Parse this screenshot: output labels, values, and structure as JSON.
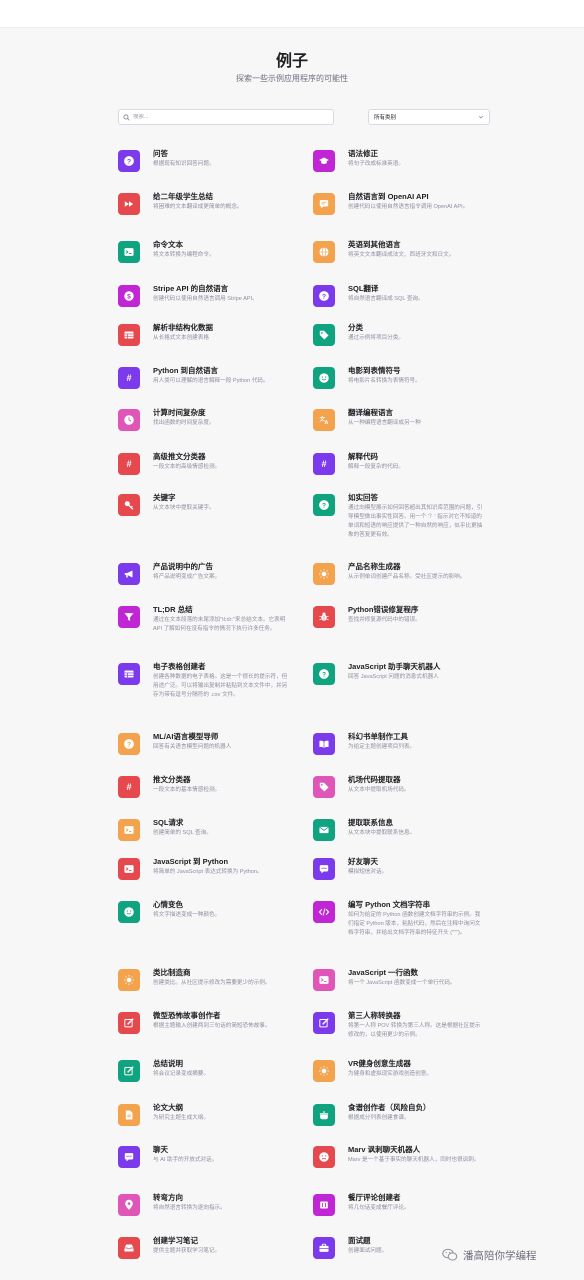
{
  "header": {
    "title": "例子",
    "subtitle": "探索一些示例应用程序的可能性"
  },
  "search": {
    "placeholder": "搜索..."
  },
  "category_select": {
    "value": "所有类别"
  },
  "colors": {
    "purple": "#7c3aed",
    "red": "#e5484d",
    "orange": "#f3a24d",
    "green": "#10a37f",
    "pink": "#e056b8",
    "magenta": "#c026d3"
  },
  "examples": [
    {
      "title": "问答",
      "desc": "根据现有知识回答问题。",
      "color": "#7c3aed",
      "icon": "question-icon"
    },
    {
      "title": "语法修正",
      "desc": "将句子改成标准英语。",
      "color": "#c026d3",
      "icon": "graduation-cap-icon"
    },
    {
      "title": "给二年级学生总结",
      "desc": "将困难的文本翻译成更简单的概念。",
      "color": "#e5484d",
      "icon": "fast-forward-icon"
    },
    {
      "title": "自然语言到 OpenAI API",
      "desc": "创建代码以使用自然语言指令调用 OpenAI API。",
      "color": "#f3a24d",
      "icon": "message-code-icon"
    },
    {
      "title": "命令文本",
      "desc": "将文本转换为编程命令。",
      "color": "#10a37f",
      "icon": "terminal-icon"
    },
    {
      "title": "英语到其他语言",
      "desc": "将英文文本翻译成法文、西班牙文和日文。",
      "color": "#f3a24d",
      "icon": "globe-icon"
    },
    {
      "title": "Stripe API 的自然语言",
      "desc": "创建代码以使用自然语言调用 Stripe API。",
      "color": "#c026d3",
      "icon": "dollar-icon"
    },
    {
      "title": "SQL翻译",
      "desc": "将自然语言翻译成 SQL 查询。",
      "color": "#7c3aed",
      "icon": "question-icon"
    },
    {
      "title": "解析非结构化数据",
      "desc": "从长格式文本创建表格",
      "color": "#e5484d",
      "icon": "table-icon"
    },
    {
      "title": "分类",
      "desc": "通过示例将项目分类。",
      "color": "#10a37f",
      "icon": "tag-icon"
    },
    {
      "title": "Python 到自然语言",
      "desc": "用人类可以理解的语言解释一段 Python 代码。",
      "color": "#7c3aed",
      "icon": "hashtag-icon"
    },
    {
      "title": "电影到表情符号",
      "desc": "将电影片名转换为表情符号。",
      "color": "#10a37f",
      "icon": "smile-icon"
    },
    {
      "title": "计算时间复杂度",
      "desc": "找出函数的时间复杂度。",
      "color": "#e056b8",
      "icon": "clock-icon"
    },
    {
      "title": "翻译编程语言",
      "desc": "从一种编程语言翻译成另一种",
      "color": "#f3a24d",
      "icon": "translate-icon"
    },
    {
      "title": "高级推文分类器",
      "desc": "一段文本的高级情感检测。",
      "color": "#e5484d",
      "icon": "hashtag-icon"
    },
    {
      "title": "解释代码",
      "desc": "解释一段复杂的代码。",
      "color": "#7c3aed",
      "icon": "hashtag-icon"
    },
    {
      "title": "关键字",
      "desc": "从文本块中提取关键字。",
      "color": "#e5484d",
      "icon": "key-icon"
    },
    {
      "title": "如实回答",
      "desc": "通过向模型展示如何回答超出其知识库范围的问题，引导模型做出事实性回答。用一个 '？' 指示对它不知道的单词和短语的响应提供了一种自然的响应，似乎比更抽象的答复更有效。",
      "color": "#10a37f",
      "icon": "question-icon"
    },
    {
      "title": "产品说明中的广告",
      "desc": "将产品说明变成广告文案。",
      "color": "#7c3aed",
      "icon": "megaphone-icon"
    },
    {
      "title": "产品名称生成器",
      "desc": "从示例单词创建产品名称。受社区提示的影响。",
      "color": "#f3a24d",
      "icon": "lightbulb-icon"
    },
    {
      "title": "TL;DR 总结",
      "desc": "通过在文本段落的末尾添加\"tl;dr:\"来总结文本。它表明 API 了解如何在没有指令的情况下执行许多任务。",
      "color": "#c026d3",
      "icon": "filter-icon"
    },
    {
      "title": "Python错误修复程序",
      "desc": "查找并修复源代码中的错误。",
      "color": "#e5484d",
      "icon": "bug-icon"
    },
    {
      "title": "电子表格创建者",
      "desc": "创建各种数据的电子表格。这是一个很长的提示符，但用途广泛。可以将输出复制并粘贴到文本文件中，并另存为带有逗号分隔符的 .csv 文件。",
      "color": "#7c3aed",
      "icon": "table-icon"
    },
    {
      "title": "JavaScript 助手聊天机器人",
      "desc": "回答 JavaScript 问题的消息式机器人",
      "color": "#10a37f",
      "icon": "question-icon"
    },
    {
      "title": "ML/AI语言模型导师",
      "desc": "回答有关语言模型问题的机器人",
      "color": "#f3a24d",
      "icon": "question-icon"
    },
    {
      "title": "科幻书单制作工具",
      "desc": "为给定主题创建项目列表。",
      "color": "#7c3aed",
      "icon": "book-open-icon"
    },
    {
      "title": "推文分类器",
      "desc": "一段文本的基本情感检测。",
      "color": "#e5484d",
      "icon": "hashtag-icon"
    },
    {
      "title": "机场代码提取器",
      "desc": "从文本中提取机场代码。",
      "color": "#e056b8",
      "icon": "tag-icon"
    },
    {
      "title": "SQL请求",
      "desc": "创建简单的 SQL 查询。",
      "color": "#f3a24d",
      "icon": "terminal-icon"
    },
    {
      "title": "提取联系信息",
      "desc": "从文本块中提取联系信息。",
      "color": "#10a37f",
      "icon": "mail-icon"
    },
    {
      "title": "JavaScript 到 Python",
      "desc": "将简单的 JavaScript 表达式转换为 Python。",
      "color": "#e5484d",
      "icon": "terminal-icon"
    },
    {
      "title": "好友聊天",
      "desc": "模拟短信对话。",
      "color": "#7c3aed",
      "icon": "chat-icon"
    },
    {
      "title": "心情变色",
      "desc": "将文字描述变成一种颜色。",
      "color": "#10a37f",
      "icon": "smile-icon"
    },
    {
      "title": "编写 Python 文档字符串",
      "desc": "如何为给定的 Python 函数创建文档字符串的示例。我们指定 Python 版本，粘贴代码，然后在注释中询问文档字符串，并给出文档字符串的特征开头 (\"\"\")。",
      "color": "#c026d3",
      "icon": "code-icon"
    },
    {
      "title": "类比制造商",
      "desc": "创建类比。从社区提示修改为需要更少的示例。",
      "color": "#f3a24d",
      "icon": "lightbulb-icon"
    },
    {
      "title": "JavaScript 一行函数",
      "desc": "将一个 JavaScript 函数变成一个单行代码。",
      "color": "#e056b8",
      "icon": "terminal-icon"
    },
    {
      "title": "微型恐怖故事创作者",
      "desc": "根据主题输入创建两到三句话的简短恐怖故事。",
      "color": "#e5484d",
      "icon": "pencil-square-icon"
    },
    {
      "title": "第三人称转换器",
      "desc": "将第一人称 POV 转换为第三人称。这是根据社区提示修改的，以使用更少的示例。",
      "color": "#7c3aed",
      "icon": "pencil-square-icon"
    },
    {
      "title": "总结说明",
      "desc": "将会议记录变成摘要。",
      "color": "#10a37f",
      "icon": "pencil-square-icon"
    },
    {
      "title": "VR健身创意生成器",
      "desc": "为健身和虚拟现实游戏创造创意。",
      "color": "#f3a24d",
      "icon": "lightbulb-icon"
    },
    {
      "title": "论文大纲",
      "desc": "为研究主题生成大纲。",
      "color": "#f3a24d",
      "icon": "document-icon"
    },
    {
      "title": "食谱创作者（风险自负）",
      "desc": "根据成分列表创建食谱。",
      "color": "#10a37f",
      "icon": "cooking-pot-icon"
    },
    {
      "title": "聊天",
      "desc": "与 AI 助手的开放式对话。",
      "color": "#7c3aed",
      "icon": "chat-icon"
    },
    {
      "title": "Marv 讽刺聊天机器人",
      "desc": "Marv 是一个基于事实的聊天机器人，同时也很讽刺。",
      "color": "#e5484d",
      "icon": "frown-icon"
    },
    {
      "title": "转弯方向",
      "desc": "将自然语言转换为逐向指示。",
      "color": "#e056b8",
      "icon": "map-pin-icon"
    },
    {
      "title": "餐厅评论创建者",
      "desc": "将几句话变成餐厅评论。",
      "color": "#c026d3",
      "icon": "restaurant-icon"
    },
    {
      "title": "创建学习笔记",
      "desc": "提供主题并获取学习笔记。",
      "color": "#e5484d",
      "icon": "inbox-icon"
    },
    {
      "title": "面试题",
      "desc": "创建面试问题。",
      "color": "#7c3aed",
      "icon": "briefcase-icon"
    }
  ],
  "watermark": {
    "text": "潘高陪你学编程",
    "icon": "wechat-icon"
  }
}
